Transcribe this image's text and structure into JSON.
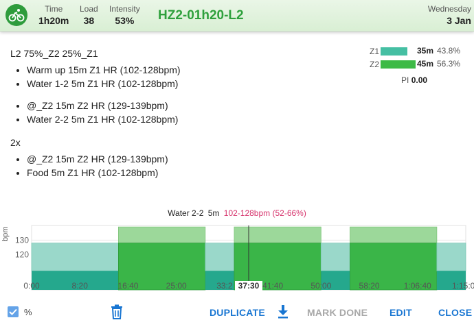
{
  "header": {
    "stats": [
      {
        "label": "Time",
        "value": "1h20m"
      },
      {
        "label": "Load",
        "value": "38"
      },
      {
        "label": "Intensity",
        "value": "53%"
      }
    ],
    "title": "HZ2-01h20-L2",
    "day_of_week": "Wednesday",
    "day_month": "3 Jan",
    "icon": "cyclist-icon"
  },
  "description": {
    "heading": "L2 75%_Z2 25%_Z1",
    "block1": [
      "Warm up 15m Z1 HR (102-128bpm)",
      "Water 1-2 5m Z1 HR (102-128bpm)"
    ],
    "block2": [
      "@_Z2 15m Z2 HR (129-139bpm)",
      "Water 2-2 5m Z1 HR (102-128bpm)"
    ],
    "repeat": "2x",
    "block3": [
      "@_Z2 15m Z2 HR (129-139bpm)",
      "Food 5m Z1 HR (102-128bpm)"
    ]
  },
  "zones": [
    {
      "name": "Z1",
      "time": "35m",
      "pct": "43.8%",
      "fraction": 0.438,
      "color": "#45bfa3"
    },
    {
      "name": "Z2",
      "time": "45m",
      "pct": "56.3%",
      "fraction": 0.563,
      "color": "#3dba46"
    }
  ],
  "pi": {
    "label": "PI",
    "value": "0.00"
  },
  "chart_head": {
    "step": "Water 2-2",
    "duration": "5m",
    "range": "102-128bpm (52-66%)"
  },
  "chart_data": {
    "type": "area",
    "ylabel": "bpm",
    "yticks": [
      "120",
      "130"
    ],
    "xticks": [
      "0:00",
      "8:20",
      "16:40",
      "25:00",
      "33:2",
      "41:40",
      "50:00",
      "58:20",
      "1:06:40",
      "1:15:00"
    ],
    "cursor_label": "37:30",
    "steps": [
      {
        "label": "Warm up",
        "start_min": 0,
        "end_min": 15,
        "zone": "Z1",
        "low_bpm": 102,
        "high_bpm": 128
      },
      {
        "label": "@_Z2",
        "start_min": 15,
        "end_min": 30,
        "zone": "Z2",
        "low_bpm": 129,
        "high_bpm": 139
      },
      {
        "label": "Water 2-2",
        "start_min": 30,
        "end_min": 35,
        "zone": "Z1",
        "low_bpm": 102,
        "high_bpm": 128
      },
      {
        "label": "@_Z2",
        "start_min": 35,
        "end_min": 50,
        "zone": "Z2",
        "low_bpm": 129,
        "high_bpm": 139
      },
      {
        "label": "Food",
        "start_min": 50,
        "end_min": 55,
        "zone": "Z1",
        "low_bpm": 102,
        "high_bpm": 128
      },
      {
        "label": "@_Z2",
        "start_min": 55,
        "end_min": 70,
        "zone": "Z2",
        "low_bpm": 129,
        "high_bpm": 139
      },
      {
        "label": "Food",
        "start_min": 70,
        "end_min": 75,
        "zone": "Z1",
        "low_bpm": 102,
        "high_bpm": 128
      }
    ]
  },
  "toolbar": {
    "percent_label": "%",
    "duplicate": "DUPLICATE",
    "mark_done": "MARK DONE",
    "edit": "EDIT",
    "close": "CLOSE"
  }
}
